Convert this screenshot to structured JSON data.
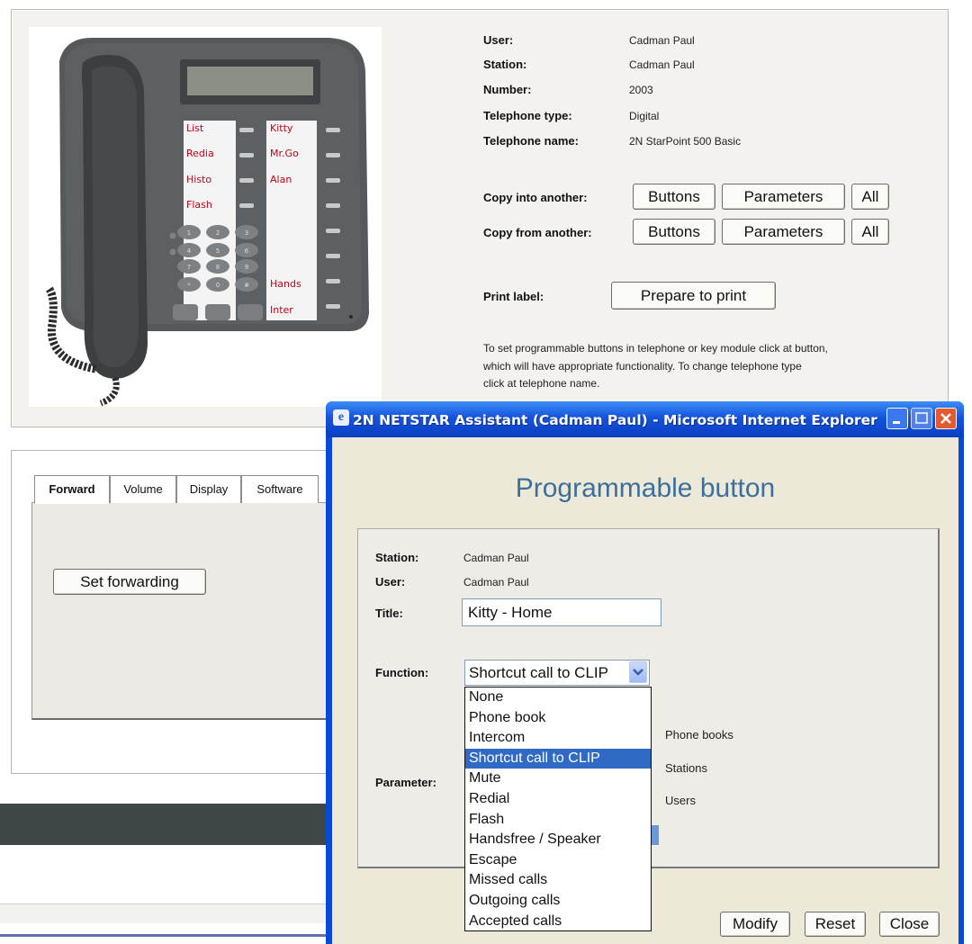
{
  "phone": {
    "left_keys": [
      "List",
      "Redia",
      "Histo",
      "Flash"
    ],
    "right_keys": [
      "Kitty",
      "Mr.Go",
      "Alan",
      "",
      "",
      "",
      "Hands",
      "Inter"
    ],
    "keypad": [
      "1",
      "2",
      "3",
      "4",
      "5",
      "6",
      "7",
      "8",
      "9",
      "*",
      "0",
      "#"
    ]
  },
  "info": {
    "user_label": "User:",
    "user_value": "Cadman Paul",
    "station_label": "Station:",
    "station_value": "Cadman Paul",
    "number_label": "Number:",
    "number_value": "2003",
    "type_label": "Telephone type:",
    "type_value": "Digital",
    "name_label": "Telephone name:",
    "name_value": "2N StarPoint 500 Basic"
  },
  "copy": {
    "into_label": "Copy into another:",
    "from_label": "Copy from another:",
    "buttons": "Buttons",
    "parameters": "Parameters",
    "all": "All"
  },
  "print": {
    "label": "Print label:",
    "button": "Prepare to print"
  },
  "help": {
    "line1": "To set programmable buttons in telephone or key module click at button,",
    "line2": "which will have appropriate functionality. To change telephone type",
    "line3": "click at telephone name."
  },
  "tabs": [
    "Forward",
    "Volume",
    "Display",
    "Software"
  ],
  "forwarding_button": "Set forwarding",
  "popup": {
    "window_title": "2N NETSTAR Assistant (Cadman Paul) - Microsoft Internet Explorer",
    "heading": "Programmable button",
    "station_label": "Station:",
    "station_value": "Cadman Paul",
    "user_label": "User:",
    "user_value": "Cadman Paul",
    "title_label": "Title:",
    "title_value": "Kitty - Home",
    "function_label": "Function:",
    "function_selected": "Shortcut call to CLIP",
    "parameter_label": "Parameter:",
    "options": [
      "None",
      "Phone book",
      "Intercom",
      "Shortcut call to CLIP",
      "Mute",
      "Redial",
      "Flash",
      "Handsfree / Speaker",
      "Escape",
      "Missed calls",
      "Outgoing calls",
      "Accepted calls"
    ],
    "selected_index": 3,
    "side_options": [
      "Phone books",
      "Stations",
      "Users"
    ],
    "modify": "Modify",
    "reset": "Reset",
    "close": "Close"
  }
}
